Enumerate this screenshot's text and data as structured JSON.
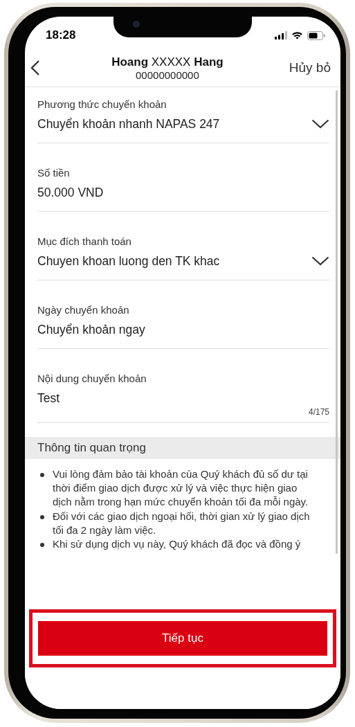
{
  "status_bar": {
    "time": "18:28"
  },
  "header": {
    "name": "**Hoang** XXXXX  **Hang**",
    "account_number": "00000000000",
    "cancel": "Hủy bỏ"
  },
  "fields": [
    {
      "kind": "dropdown",
      "label": "Phương thức chuyển khoản",
      "value": "Chuyển khoản nhanh NAPAS 247"
    },
    {
      "kind": "text",
      "label": "Số tiền",
      "value": "50.000 VND"
    },
    {
      "kind": "dropdown",
      "label": "Mục đích thanh toán",
      "value": "Chuyen khoan luong den TK khac"
    },
    {
      "kind": "text",
      "label": "Ngày chuyển khoản",
      "value": "Chuyển khoản ngay"
    },
    {
      "kind": "counted",
      "label": "Nội dung chuyển khoản",
      "value": "Test",
      "counter": "4/175"
    }
  ],
  "info": {
    "title": "Thông tin quan trọng",
    "items": [
      "Vui lòng đảm bảo tài khoản của Quý khách đủ số dư tại thời điểm giao dịch được xử lý và việc thực hiện giao dịch nằm trong hạn mức chuyển khoản tối đa mỗi ngày.",
      "Đối với các giao dịch ngoại hối, thời gian xử lý giao dịch tối đa 2 ngày làm việc.",
      "Khi sử dụng dịch vụ này, Quý khách đã đọc và đồng ý"
    ]
  },
  "continue_button": "Tiếp tục"
}
